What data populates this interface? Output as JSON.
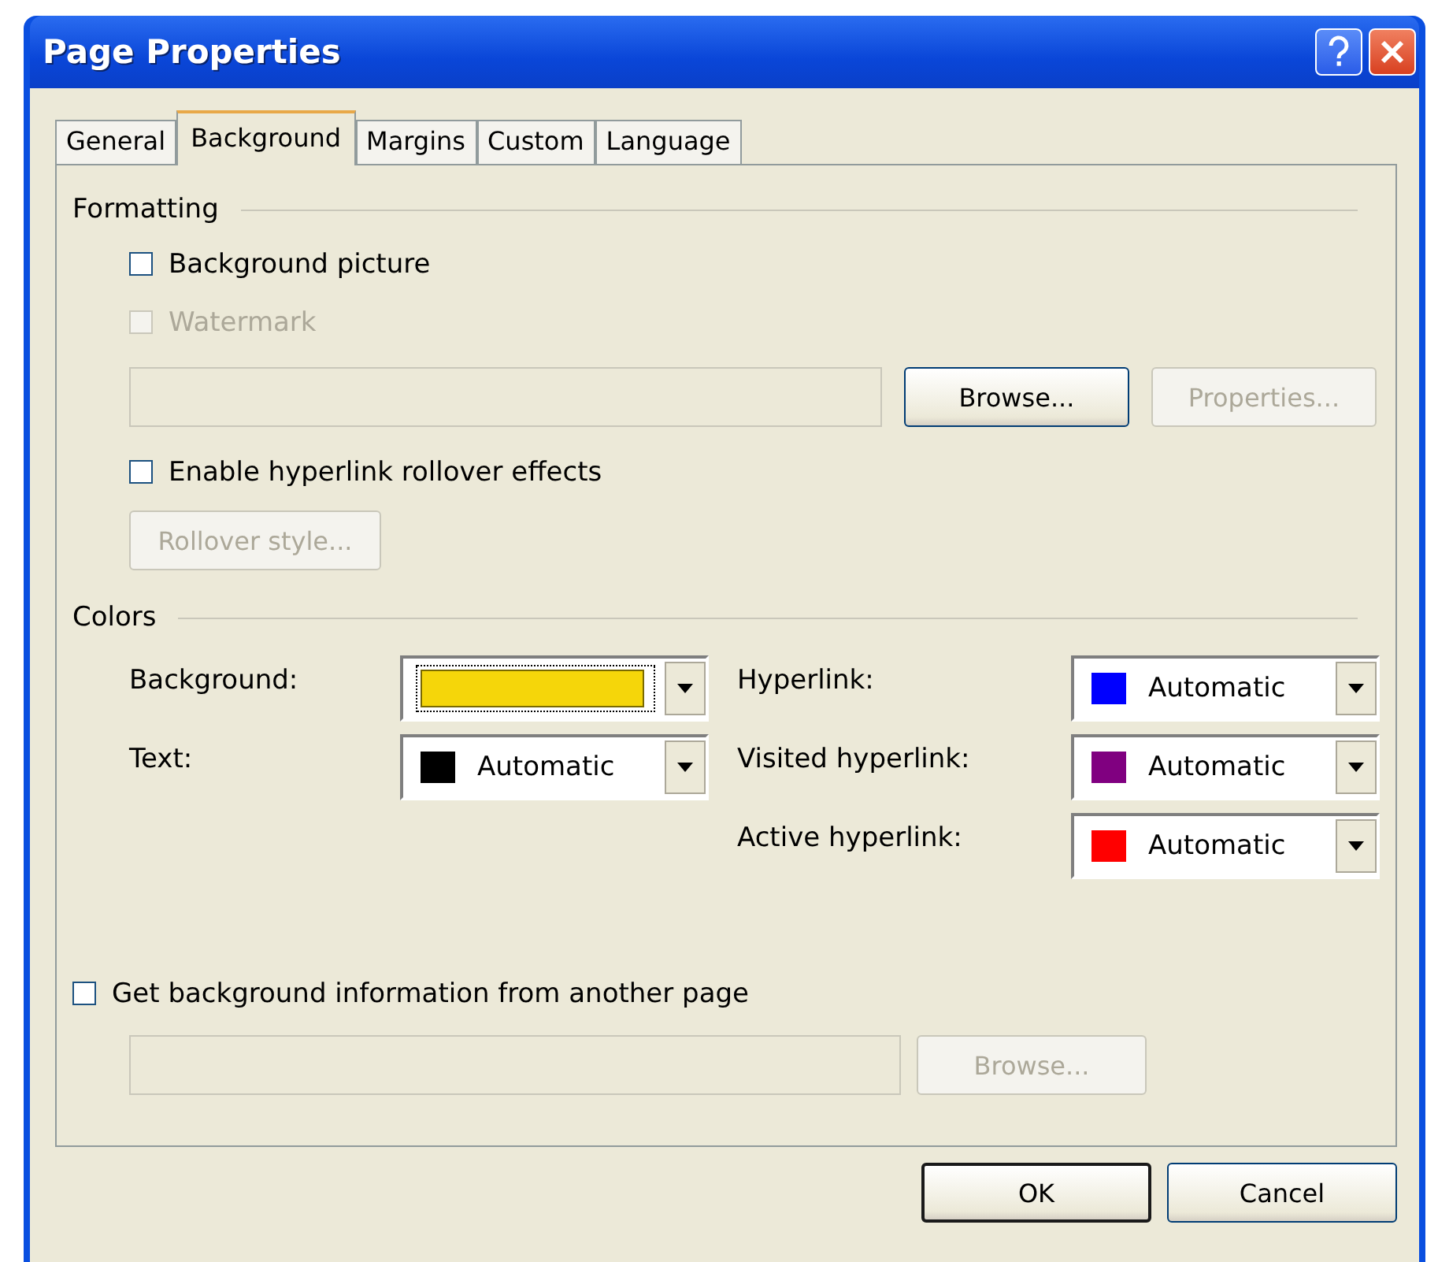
{
  "window": {
    "title": "Page Properties"
  },
  "tabs": [
    {
      "label": "General",
      "selected": false
    },
    {
      "label": "Background",
      "selected": true
    },
    {
      "label": "Margins",
      "selected": false
    },
    {
      "label": "Custom",
      "selected": false
    },
    {
      "label": "Language",
      "selected": false
    }
  ],
  "formatting": {
    "title": "Formatting",
    "background_picture": {
      "label": "Background picture",
      "checked": false,
      "disabled": false
    },
    "watermark": {
      "label": "Watermark",
      "checked": false,
      "disabled": true
    },
    "path_field": {
      "disabled": true
    },
    "browse_button": {
      "label": "Browse...",
      "disabled": false
    },
    "properties_button": {
      "label": "Properties...",
      "disabled": true
    },
    "rollover": {
      "label": "Enable hyperlink rollover effects",
      "checked": false,
      "disabled": false
    },
    "rollover_button": {
      "label": "Rollover style...",
      "disabled": true
    }
  },
  "colors": {
    "title": "Colors",
    "page_colors": [
      {
        "label": "Background:",
        "color": "#f5d60a",
        "focused": true
      },
      {
        "label": "Text:",
        "color": "#000000",
        "value": "Automatic",
        "focused": false
      }
    ],
    "link_colors": [
      {
        "label": "Hyperlink:",
        "color": "#0000ff",
        "value": "Automatic",
        "focused": false
      },
      {
        "label": "Visited hyperlink:",
        "color": "#800080",
        "value": "Automatic",
        "focused": false
      },
      {
        "label": "Active hyperlink:",
        "color": "#ff0000",
        "value": "Automatic",
        "focused": false
      }
    ]
  },
  "other_page": {
    "label": "Get background information from another page",
    "checked": false,
    "disabled": false,
    "path_field": {
      "disabled": true
    },
    "browse_button": {
      "label": "Browse...",
      "disabled": true
    }
  },
  "buttons": [
    {
      "label": "OK",
      "default": true
    },
    {
      "label": "Cancel",
      "default": false
    }
  ]
}
